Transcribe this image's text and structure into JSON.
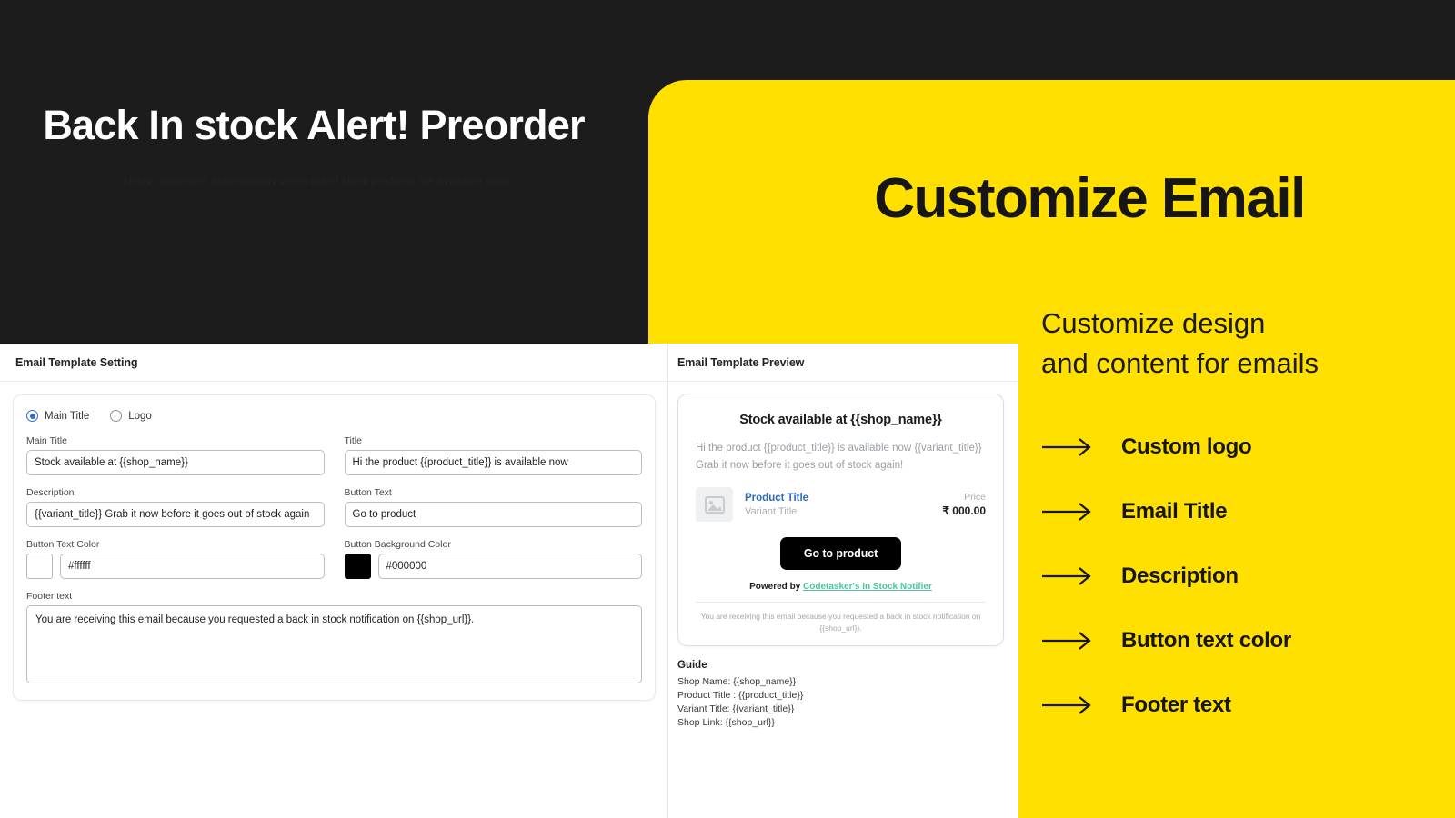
{
  "hero": {
    "title": "Back In stock Alert! Preorder",
    "subtitle": "Notify customers automatically when out of stock products are available again"
  },
  "promo": {
    "heading": "Customize Email",
    "subheading_line1": "Customize design",
    "subheading_line2": "and content for emails",
    "accent_color": "#FFE000",
    "dark_color": "#1c1c1c",
    "features": [
      {
        "icon": "arrow-right-icon",
        "label": "Custom logo"
      },
      {
        "icon": "arrow-right-icon",
        "label": "Email Title"
      },
      {
        "icon": "arrow-right-icon",
        "label": "Description"
      },
      {
        "icon": "arrow-right-icon",
        "label": "Button text color"
      },
      {
        "icon": "arrow-right-icon",
        "label": "Footer text"
      }
    ]
  },
  "settings_pane": {
    "heading": "Email Template Setting",
    "mode_options": [
      {
        "label": "Main Title",
        "selected": true
      },
      {
        "label": "Logo",
        "selected": false
      }
    ],
    "fields": {
      "main_title": {
        "label": "Main Title",
        "value": "Stock available at {{shop_name}}"
      },
      "title": {
        "label": "Title",
        "value": "Hi the product {{product_title}} is available now"
      },
      "description": {
        "label": "Description",
        "value": "{{variant_title}} Grab it now before it goes out of stock again"
      },
      "button_text": {
        "label": "Button Text",
        "value": "Go to product"
      },
      "button_text_color": {
        "label": "Button Text Color",
        "value": "#ffffff",
        "swatch": "#ffffff"
      },
      "button_background_color": {
        "label": "Button Background Color",
        "value": "#000000",
        "swatch": "#000000"
      },
      "footer_text": {
        "label": "Footer text",
        "value": "You are receiving this email because you requested a back in stock notification on {{shop_url}}."
      }
    }
  },
  "preview_pane": {
    "heading": "Email Template Preview",
    "email": {
      "title": "Stock available at {{shop_name}}",
      "body": "Hi the product {{product_title}} is available now {{variant_title}} Grab it now before it goes out of stock again!",
      "product_name": "Product Title",
      "variant_name": "Variant Title",
      "price_label": "Price",
      "price_value": "₹ 000.00",
      "cta_label": "Go to product",
      "powered_prefix": "Powered by ",
      "powered_link": "Codetasker's In Stock Notifier",
      "footnote": "You are receiving this email because you requested a back in stock notification on {{shop_url}}."
    },
    "guide": {
      "title": "Guide",
      "lines": [
        "Shop Name: {{shop_name}}",
        "Product Title : {{product_title}}",
        "Variant Title: {{variant_title}}",
        "Shop Link: {{shop_url}}"
      ]
    }
  }
}
